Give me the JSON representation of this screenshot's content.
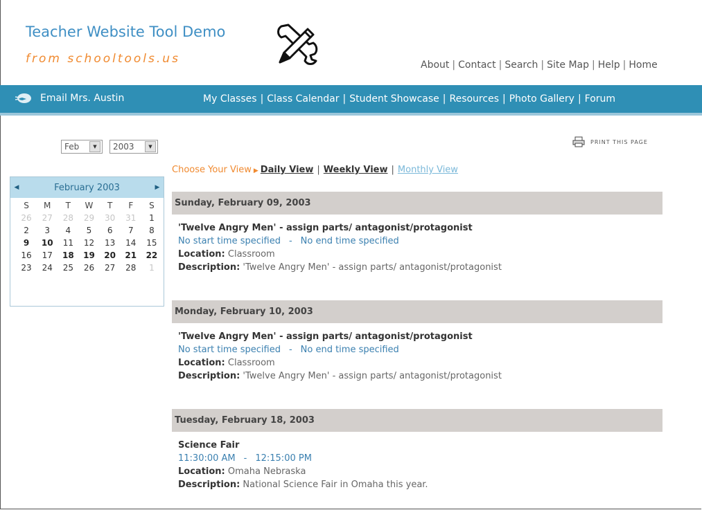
{
  "header": {
    "title": "Teacher Website Tool Demo",
    "subtitle": "from schooltools.us",
    "logo_icon": "pencil-wrench-icon",
    "top_links": [
      "About",
      "Contact",
      "Search",
      "Site Map",
      "Help",
      "Home"
    ]
  },
  "nav": {
    "email_label": "Email Mrs. Austin",
    "email_icon": "email-icon",
    "links": [
      "My Classes",
      "Class Calendar",
      "Student Showcase",
      "Resources",
      "Photo Gallery",
      "Forum"
    ]
  },
  "calendar_controls": {
    "month_value": "Feb",
    "year_value": "2003"
  },
  "mini_calendar": {
    "title": "February 2003",
    "weekdays": [
      "S",
      "M",
      "T",
      "W",
      "T",
      "F",
      "S"
    ],
    "weeks": [
      [
        "26",
        "27",
        "28",
        "29",
        "30",
        "31",
        "1"
      ],
      [
        "2",
        "3",
        "4",
        "5",
        "6",
        "7",
        "8"
      ],
      [
        "9",
        "10",
        "11",
        "12",
        "13",
        "14",
        "15"
      ],
      [
        "16",
        "17",
        "18",
        "19",
        "20",
        "21",
        "22"
      ],
      [
        "23",
        "24",
        "25",
        "26",
        "27",
        "28",
        "1"
      ]
    ],
    "muted": [
      "0-0",
      "0-1",
      "0-2",
      "0-3",
      "0-4",
      "0-5",
      "4-6"
    ],
    "bold": [
      "2-0",
      "2-1",
      "3-2",
      "3-3",
      "3-4",
      "3-5",
      "3-6"
    ]
  },
  "print_label": "PRINT THIS PAGE",
  "view_chooser": {
    "label": "Choose Your View",
    "daily": "Daily View",
    "weekly": "Weekly View",
    "monthly": "Monthly View"
  },
  "days": [
    {
      "header": "Sunday, February 09, 2003",
      "event": {
        "title": "'Twelve Angry Men' - assign parts/ antagonist/protagonist",
        "start": "No start time specified",
        "end": "No end time specified",
        "location_label": "Location:",
        "location": "Classroom",
        "description_label": "Description:",
        "description": "'Twelve Angry Men' - assign parts/ antagonist/protagonist"
      }
    },
    {
      "header": "Monday, February 10, 2003",
      "event": {
        "title": "'Twelve Angry Men' - assign parts/ antagonist/protagonist",
        "start": "No start time specified",
        "end": "No end time specified",
        "location_label": "Location:",
        "location": "Classroom",
        "description_label": "Description:",
        "description": "'Twelve Angry Men' - assign parts/ antagonist/protagonist"
      }
    },
    {
      "header": "Tuesday, February 18, 2003",
      "event": {
        "title": "Science Fair",
        "start": "11:30:00 AM",
        "end": "12:15:00 PM",
        "location_label": "Location:",
        "location": "Omaha Nebraska",
        "description_label": "Description:",
        "description": "National Science Fair in Omaha this year."
      }
    }
  ]
}
